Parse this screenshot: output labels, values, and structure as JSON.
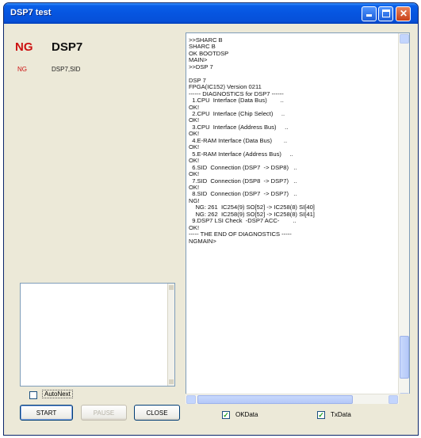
{
  "window": {
    "title": "DSP7 test"
  },
  "status": {
    "result_large": "NG",
    "device_large": "DSP7",
    "result_small": "NG",
    "device_small": "DSP7,SID"
  },
  "controls": {
    "autonext_label": "AutoNext",
    "autonext_checked": false,
    "start_label": "START",
    "pause_label": "PAUSE",
    "close_label": "CLOSE"
  },
  "log": {
    "lines": [
      ">>SHARC B",
      "SHARC B",
      "OK BOOTDSP",
      "MAIN>",
      ">>DSP 7",
      "",
      "DSP 7",
      "FPGA(IC152) Version 0211",
      "------ DIAGNOSTICS for DSP7 ------",
      "  1.CPU  Interface (Data Bus)        ..",
      "OK!",
      "  2.CPU  Interface (Chip Select)     ..",
      "OK!",
      "  3.CPU  Interface (Address Bus)     ..",
      "OK!",
      "  4.E-RAM Interface (Data Bus)       ..",
      "OK!",
      "  5.E-RAM Interface (Address Bus)     ..",
      "OK!",
      "  6.SID  Connection (DSP7  -> DSP8)   ..",
      "OK!",
      "  7.SID  Connection (DSP8  -> DSP7)   ..",
      "OK!",
      "  8.SID  Connection (DSP7  -> DSP7)   ..",
      "NG!",
      "    NG: 261  IC254(9) SO[52] -> IC258(8) SI[40]",
      "    NG: 262  IC258(9) SO[52] -> IC258(8) SI[41]",
      "  9.DSP7 LSI Check  -DSP7 ACC-        ..",
      "OK!",
      "----- THE END OF DIAGNOSTICS -----",
      "NGMAIN>"
    ]
  },
  "footer": {
    "okdata_label": "OKData",
    "okdata_checked": true,
    "txdata_label": "TxData",
    "txdata_checked": true
  },
  "icons": {
    "minimize": "minimize-icon",
    "maximize": "maximize-icon",
    "close": "close-icon",
    "check": "✓"
  }
}
